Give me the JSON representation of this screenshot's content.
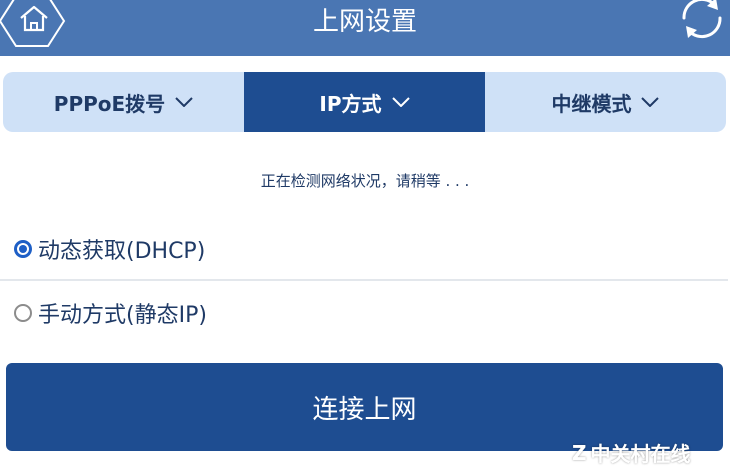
{
  "header": {
    "title": "上网设置",
    "home_icon": "home-icon",
    "refresh_icon": "refresh-icon"
  },
  "tabs": [
    {
      "label": "PPPoE拨号",
      "active": false
    },
    {
      "label": "IP方式",
      "active": true
    },
    {
      "label": "中继模式",
      "active": false
    }
  ],
  "status": {
    "text": "正在检测网络状况，请稍等 . . ."
  },
  "options": [
    {
      "label": "动态获取(DHCP)",
      "selected": true
    },
    {
      "label": "手动方式(静态IP)",
      "selected": false
    }
  ],
  "connect": {
    "label": "连接上网"
  },
  "watermark": {
    "logo": "Z",
    "text": "中关村在线"
  },
  "colors": {
    "header_bg": "#4a76b3",
    "tab_bar_bg": "#cfe1f7",
    "active_tab_bg": "#1e4d91",
    "button_bg": "#1e4d91",
    "radio_selected": "#1e5fc6",
    "text_dark": "#1f3a66"
  }
}
